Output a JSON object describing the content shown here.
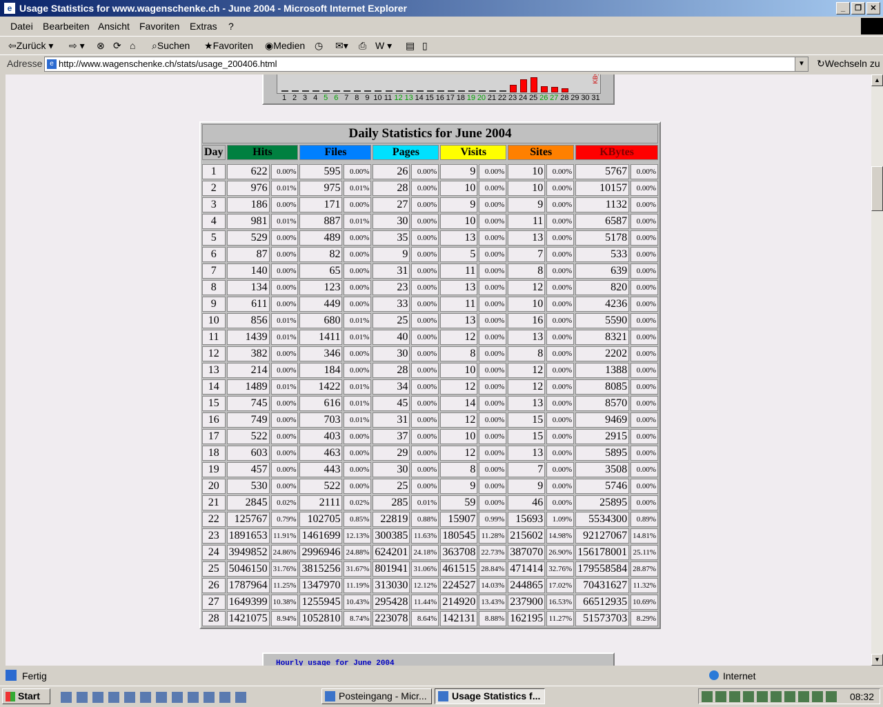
{
  "window": {
    "title": "Usage Statistics for www.wagenschenke.ch - June 2004 - Microsoft Internet Explorer"
  },
  "menu": [
    "Datei",
    "Bearbeiten",
    "Ansicht",
    "Favoriten",
    "Extras",
    "?"
  ],
  "toolbar": {
    "back": "Zurück",
    "search": "Suchen",
    "favorites": "Favoriten",
    "media": "Medien"
  },
  "address": {
    "label": "Adresse",
    "url": "http://www.wagenschenke.ch/stats/usage_200406.html",
    "go": "Wechseln zu"
  },
  "graph": {
    "side_label": "KBytes",
    "days": [
      "1",
      "2",
      "3",
      "4",
      "5",
      "6",
      "7",
      "8",
      "9",
      "10",
      "11",
      "12",
      "13",
      "14",
      "15",
      "16",
      "17",
      "18",
      "19",
      "20",
      "21",
      "22",
      "23",
      "24",
      "25",
      "26",
      "27",
      "28",
      "29",
      "30",
      "31"
    ],
    "weekend_days": [
      "5",
      "6",
      "12",
      "13",
      "19",
      "20",
      "26",
      "27"
    ]
  },
  "table": {
    "title": "Daily Statistics for June 2004",
    "headers": [
      {
        "label": "Day",
        "color": "#c0c0c0"
      },
      {
        "label": "Hits",
        "color": "#008040"
      },
      {
        "label": "Files",
        "color": "#0080ff"
      },
      {
        "label": "Pages",
        "color": "#00e0ff"
      },
      {
        "label": "Visits",
        "color": "#ffff00"
      },
      {
        "label": "Sites",
        "color": "#ff8000"
      },
      {
        "label": "KBytes",
        "color": "#ff0000"
      }
    ],
    "rows": [
      [
        "1",
        "622",
        "0.00%",
        "595",
        "0.00%",
        "26",
        "0.00%",
        "9",
        "0.00%",
        "10",
        "0.00%",
        "5767",
        "0.00%"
      ],
      [
        "2",
        "976",
        "0.01%",
        "975",
        "0.01%",
        "28",
        "0.00%",
        "10",
        "0.00%",
        "10",
        "0.00%",
        "10157",
        "0.00%"
      ],
      [
        "3",
        "186",
        "0.00%",
        "171",
        "0.00%",
        "27",
        "0.00%",
        "9",
        "0.00%",
        "9",
        "0.00%",
        "1132",
        "0.00%"
      ],
      [
        "4",
        "981",
        "0.01%",
        "887",
        "0.01%",
        "30",
        "0.00%",
        "10",
        "0.00%",
        "11",
        "0.00%",
        "6587",
        "0.00%"
      ],
      [
        "5",
        "529",
        "0.00%",
        "489",
        "0.00%",
        "35",
        "0.00%",
        "13",
        "0.00%",
        "13",
        "0.00%",
        "5178",
        "0.00%"
      ],
      [
        "6",
        "87",
        "0.00%",
        "82",
        "0.00%",
        "9",
        "0.00%",
        "5",
        "0.00%",
        "7",
        "0.00%",
        "533",
        "0.00%"
      ],
      [
        "7",
        "140",
        "0.00%",
        "65",
        "0.00%",
        "31",
        "0.00%",
        "11",
        "0.00%",
        "8",
        "0.00%",
        "639",
        "0.00%"
      ],
      [
        "8",
        "134",
        "0.00%",
        "123",
        "0.00%",
        "23",
        "0.00%",
        "13",
        "0.00%",
        "12",
        "0.00%",
        "820",
        "0.00%"
      ],
      [
        "9",
        "611",
        "0.00%",
        "449",
        "0.00%",
        "33",
        "0.00%",
        "11",
        "0.00%",
        "10",
        "0.00%",
        "4236",
        "0.00%"
      ],
      [
        "10",
        "856",
        "0.01%",
        "680",
        "0.01%",
        "25",
        "0.00%",
        "13",
        "0.00%",
        "16",
        "0.00%",
        "5590",
        "0.00%"
      ],
      [
        "11",
        "1439",
        "0.01%",
        "1411",
        "0.01%",
        "40",
        "0.00%",
        "12",
        "0.00%",
        "13",
        "0.00%",
        "8321",
        "0.00%"
      ],
      [
        "12",
        "382",
        "0.00%",
        "346",
        "0.00%",
        "30",
        "0.00%",
        "8",
        "0.00%",
        "8",
        "0.00%",
        "2202",
        "0.00%"
      ],
      [
        "13",
        "214",
        "0.00%",
        "184",
        "0.00%",
        "28",
        "0.00%",
        "10",
        "0.00%",
        "12",
        "0.00%",
        "1388",
        "0.00%"
      ],
      [
        "14",
        "1489",
        "0.01%",
        "1422",
        "0.01%",
        "34",
        "0.00%",
        "12",
        "0.00%",
        "12",
        "0.00%",
        "8085",
        "0.00%"
      ],
      [
        "15",
        "745",
        "0.00%",
        "616",
        "0.01%",
        "45",
        "0.00%",
        "14",
        "0.00%",
        "13",
        "0.00%",
        "8570",
        "0.00%"
      ],
      [
        "16",
        "749",
        "0.00%",
        "703",
        "0.01%",
        "31",
        "0.00%",
        "12",
        "0.00%",
        "15",
        "0.00%",
        "9469",
        "0.00%"
      ],
      [
        "17",
        "522",
        "0.00%",
        "403",
        "0.00%",
        "37",
        "0.00%",
        "10",
        "0.00%",
        "15",
        "0.00%",
        "2915",
        "0.00%"
      ],
      [
        "18",
        "603",
        "0.00%",
        "463",
        "0.00%",
        "29",
        "0.00%",
        "12",
        "0.00%",
        "13",
        "0.00%",
        "5895",
        "0.00%"
      ],
      [
        "19",
        "457",
        "0.00%",
        "443",
        "0.00%",
        "30",
        "0.00%",
        "8",
        "0.00%",
        "7",
        "0.00%",
        "3508",
        "0.00%"
      ],
      [
        "20",
        "530",
        "0.00%",
        "522",
        "0.00%",
        "25",
        "0.00%",
        "9",
        "0.00%",
        "9",
        "0.00%",
        "5746",
        "0.00%"
      ],
      [
        "21",
        "2845",
        "0.02%",
        "2111",
        "0.02%",
        "285",
        "0.01%",
        "59",
        "0.00%",
        "46",
        "0.00%",
        "25895",
        "0.00%"
      ],
      [
        "22",
        "125767",
        "0.79%",
        "102705",
        "0.85%",
        "22819",
        "0.88%",
        "15907",
        "0.99%",
        "15693",
        "1.09%",
        "5534300",
        "0.89%"
      ],
      [
        "23",
        "1891653",
        "11.91%",
        "1461699",
        "12.13%",
        "300385",
        "11.63%",
        "180545",
        "11.28%",
        "215602",
        "14.98%",
        "92127067",
        "14.81%"
      ],
      [
        "24",
        "3949852",
        "24.86%",
        "2996946",
        "24.88%",
        "624201",
        "24.18%",
        "363708",
        "22.73%",
        "387070",
        "26.90%",
        "156178001",
        "25.11%"
      ],
      [
        "25",
        "5046150",
        "31.76%",
        "3815256",
        "31.67%",
        "801941",
        "31.06%",
        "461515",
        "28.84%",
        "471414",
        "32.76%",
        "179558584",
        "28.87%"
      ],
      [
        "26",
        "1787964",
        "11.25%",
        "1347970",
        "11.19%",
        "313030",
        "12.12%",
        "224527",
        "14.03%",
        "244865",
        "17.02%",
        "70431627",
        "11.32%"
      ],
      [
        "27",
        "1649399",
        "10.38%",
        "1255945",
        "10.43%",
        "295428",
        "11.44%",
        "214920",
        "13.43%",
        "237900",
        "16.53%",
        "66512935",
        "10.69%"
      ],
      [
        "28",
        "1421075",
        "8.94%",
        "1052810",
        "8.74%",
        "223078",
        "8.64%",
        "142131",
        "8.88%",
        "162195",
        "11.27%",
        "51573703",
        "8.29%"
      ]
    ]
  },
  "hourly": {
    "label": "Hourly usage for June 2004"
  },
  "status": {
    "text": "Fertig",
    "zone": "Internet"
  },
  "taskbar": {
    "start": "Start",
    "tasks": [
      "Posteingang - Micr...",
      "Usage Statistics f..."
    ],
    "clock": "08:32"
  }
}
